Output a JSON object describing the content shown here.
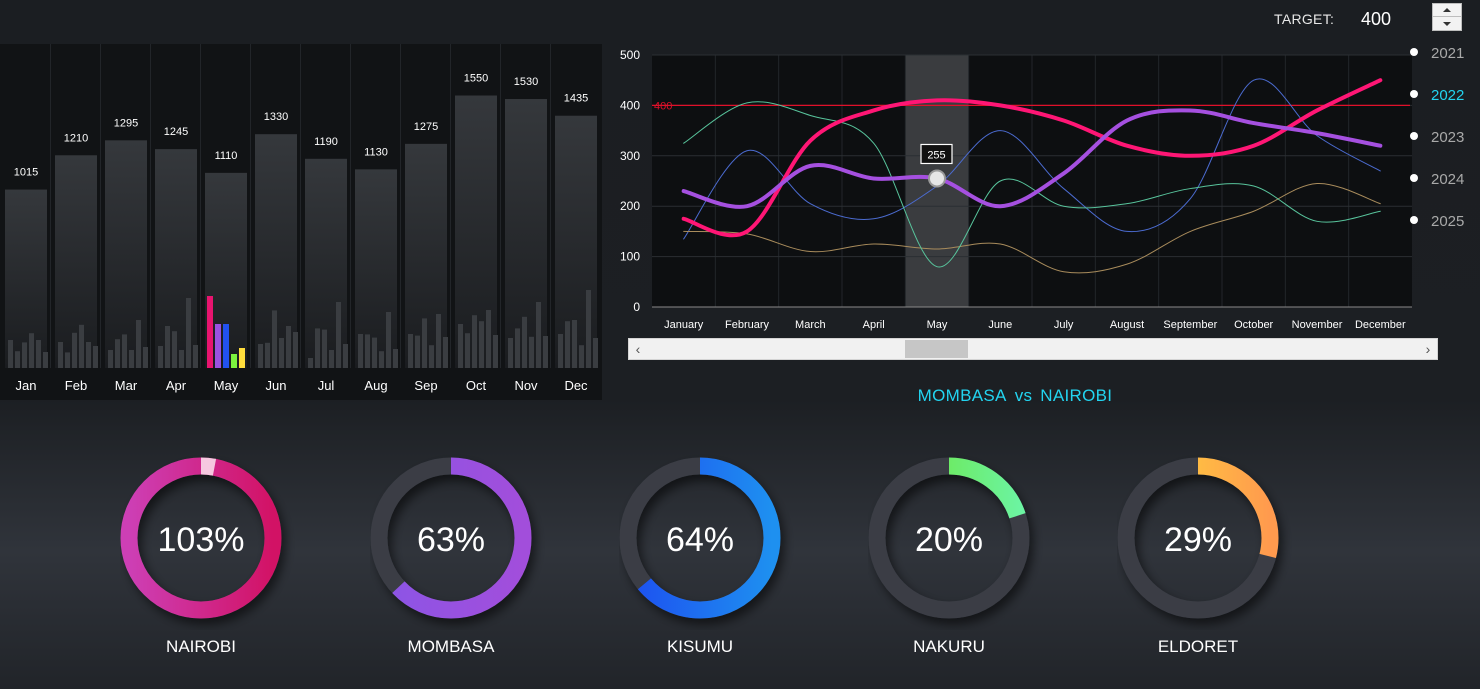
{
  "target": {
    "label": "TARGET:",
    "value": "400"
  },
  "bar_chart": {
    "months": [
      "Jan",
      "Feb",
      "Mar",
      "Apr",
      "May",
      "Jun",
      "Jul",
      "Aug",
      "Sep",
      "Oct",
      "Nov",
      "Dec"
    ],
    "totals": [
      1015,
      1210,
      1295,
      1245,
      1110,
      1330,
      1190,
      1130,
      1275,
      1550,
      1530,
      1435
    ],
    "highlight_month": "May",
    "highlight_colors": [
      "#e8146f",
      "#9b52e0",
      "#2252f0",
      "#7cf23e",
      "#ffdd3c"
    ],
    "background_color": "#111315"
  },
  "chart_data": {
    "type": "line",
    "categories": [
      "January",
      "February",
      "March",
      "April",
      "May",
      "June",
      "July",
      "August",
      "September",
      "October",
      "November",
      "December"
    ],
    "ylim": [
      0,
      500
    ],
    "yticks": [
      0,
      100,
      200,
      300,
      400,
      500
    ],
    "grid": true,
    "target_line": {
      "value": 400,
      "label": "400",
      "color": "#e0102a"
    },
    "highlight_category": "May",
    "tooltip": {
      "category": "May",
      "value": "255"
    },
    "legend": {
      "placement": "right",
      "selected": "2022"
    },
    "series": [
      {
        "name": "2021",
        "color": "#4b6bd0",
        "width": 1,
        "values": [
          135,
          310,
          205,
          175,
          240,
          350,
          235,
          150,
          215,
          450,
          340,
          270
        ]
      },
      {
        "name": "2022",
        "color": "#ff1675",
        "width": 4,
        "values": [
          175,
          150,
          330,
          390,
          410,
          400,
          370,
          320,
          300,
          320,
          390,
          450
        ]
      },
      {
        "name": "2023",
        "color": "#a550e0",
        "width": 4,
        "values": [
          230,
          200,
          280,
          255,
          255,
          200,
          265,
          370,
          390,
          365,
          345,
          320
        ]
      },
      {
        "name": "2024",
        "color": "#a98c5c",
        "width": 1,
        "values": [
          150,
          145,
          110,
          125,
          115,
          125,
          70,
          85,
          150,
          190,
          245,
          205
        ]
      },
      {
        "name": "2025",
        "color": "#58c49c",
        "width": 1,
        "values": [
          325,
          405,
          380,
          325,
          80,
          250,
          200,
          205,
          235,
          240,
          170,
          190
        ]
      }
    ]
  },
  "comparison": {
    "left": "MOMBASA",
    "vs": "vs",
    "right": "NAIROBI",
    "color": "#23d4f0"
  },
  "gauges": [
    {
      "city": "NAIROBI",
      "percent": "103%",
      "fraction": 1.03,
      "colors": [
        "#d21265",
        "#cd3fb5"
      ]
    },
    {
      "city": "MOMBASA",
      "percent": "63%",
      "fraction": 0.63,
      "colors": [
        "#a24edb",
        "#8b55e6"
      ]
    },
    {
      "city": "KISUMU",
      "percent": "64%",
      "fraction": 0.64,
      "colors": [
        "#1e90f0",
        "#1d4ff0"
      ]
    },
    {
      "city": "NAKURU",
      "percent": "20%",
      "fraction": 0.2,
      "colors": [
        "#6cf4a2",
        "#6ee22e"
      ]
    },
    {
      "city": "ELDORET",
      "percent": "29%",
      "fraction": 0.29,
      "colors": [
        "#ff9a4e",
        "#ffdb3a"
      ]
    }
  ]
}
